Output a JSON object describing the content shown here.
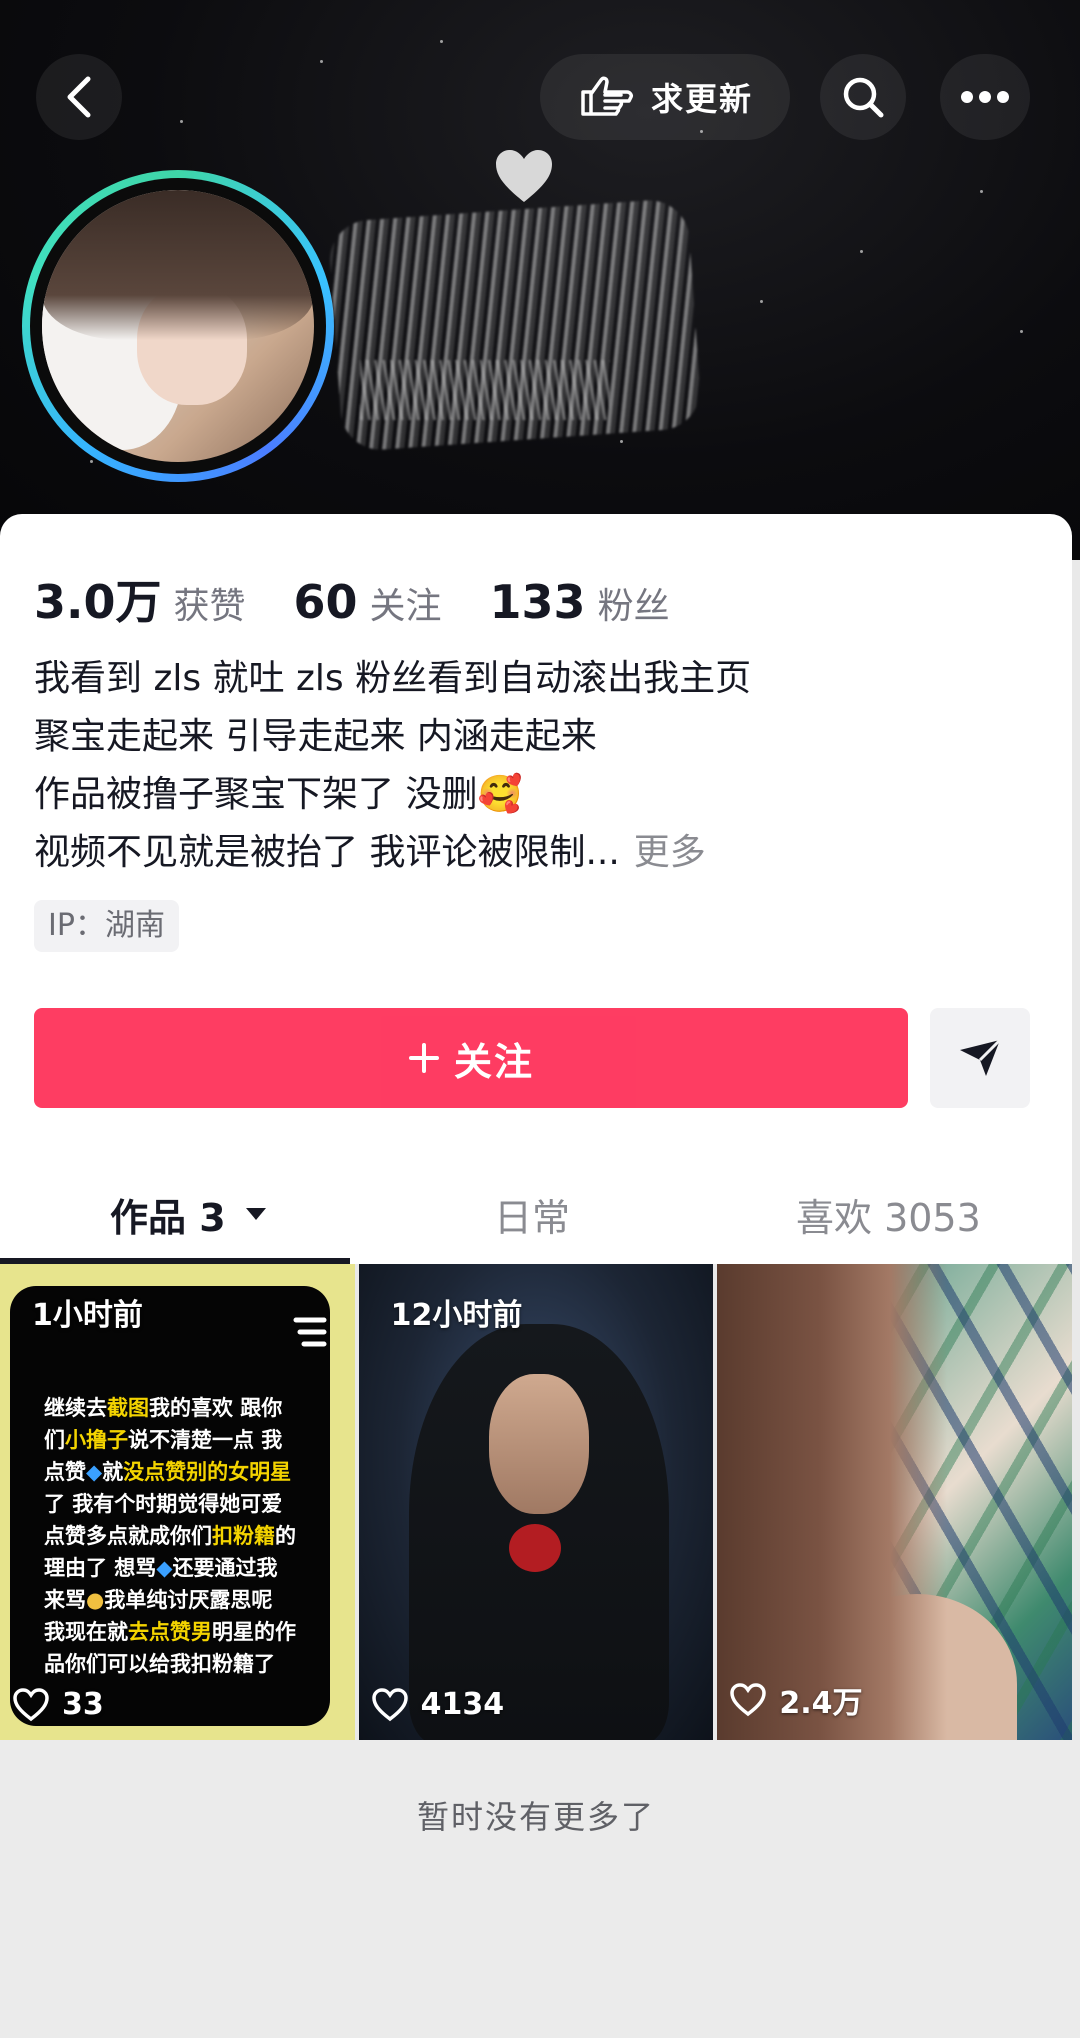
{
  "header": {
    "update_label": "求更新"
  },
  "stats": {
    "likes_value": "3.0万",
    "likes_label": "获赞",
    "following_value": "60",
    "following_label": "关注",
    "followers_value": "133",
    "followers_label": "粉丝"
  },
  "bio": {
    "line1": "我看到 zls 就吐 zls 粉丝看到自动滚出我主页",
    "line2": "聚宝走起来 引导走起来 内涵走起来",
    "line3": "作品被撸子聚宝下架了 没删🥰",
    "line4": "视频不见就是被抬了 我评论被限制...",
    "more_label": "更多"
  },
  "ip_label": "IP：湖南",
  "follow_button": {
    "icon": "plus-icon",
    "label": "关注"
  },
  "tabs": [
    {
      "label": "作品 3"
    },
    {
      "label": "日常"
    },
    {
      "label": "喜欢 3053"
    }
  ],
  "videos": [
    {
      "time": "1小时前",
      "likes": "33"
    },
    {
      "time": "12小时前",
      "likes": "4134"
    },
    {
      "time": "",
      "likes": "2.4万"
    }
  ],
  "video1_note": {
    "line1_pre": "继续去",
    "line1_hl": "截图",
    "line1_post": "我的喜欢 跟你",
    "line2_pre": "们",
    "line2_hl": "小撸子",
    "line2_post": "说不清楚一点 我",
    "line3_pre": "点赞",
    "line3_mid": "就",
    "line3_hl": "没点赞别的女明星",
    "line4": "了 我有个时期觉得她可爱",
    "line5_pre": "点赞多点就成你们",
    "line5_hl": "扣粉籍",
    "line5_post": "的",
    "line6": "理由了 想骂",
    "line6_post": "还要通过我",
    "line7": "来骂",
    "line7_post": "我单纯讨厌露思呢",
    "line8_pre": "我现在就",
    "line8_hl": "去点赞男",
    "line8_post": "明星的作",
    "line9": "品你们可以给我扣粉籍了"
  },
  "footer": {
    "no_more": "暂时没有更多了"
  },
  "colors": {
    "follow_red": "#fe2c55",
    "highlight_yellow": "#f4d400",
    "avatar_ring": "#39c2ff"
  }
}
